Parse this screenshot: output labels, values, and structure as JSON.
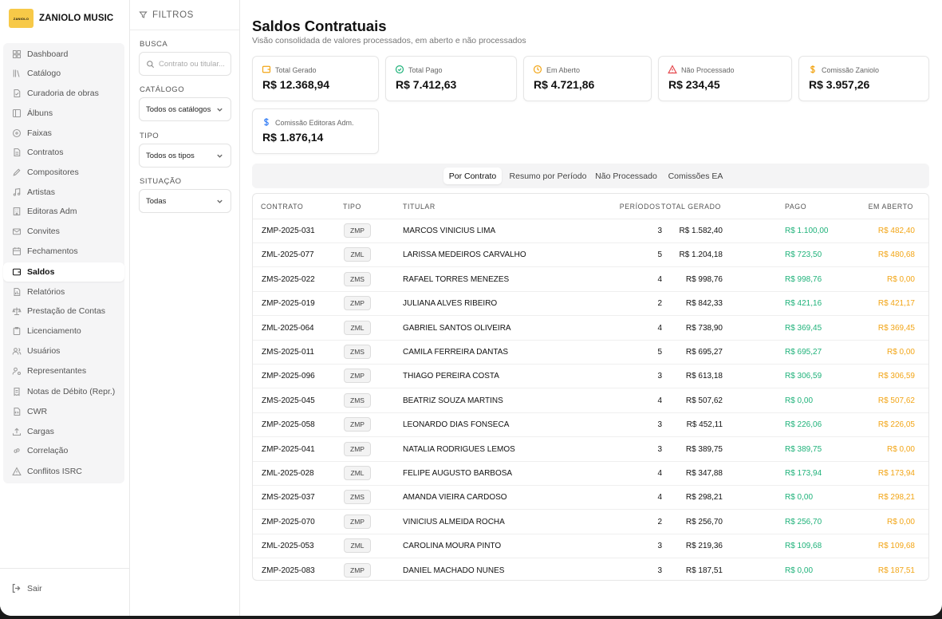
{
  "brand": {
    "logo_text": "ZANIOLO",
    "name": "ZANIOLO MUSIC"
  },
  "sidebar": {
    "items": [
      {
        "label": "Dashboard",
        "icon": "grid-icon",
        "active": false
      },
      {
        "label": "Catálogo",
        "icon": "library-icon",
        "active": false
      },
      {
        "label": "Curadoria de obras",
        "icon": "document-check-icon",
        "active": false
      },
      {
        "label": "Álbuns",
        "icon": "album-icon",
        "active": false
      },
      {
        "label": "Faixas",
        "icon": "disc-icon",
        "active": false
      },
      {
        "label": "Contratos",
        "icon": "file-text-icon",
        "active": false
      },
      {
        "label": "Compositores",
        "icon": "pen-icon",
        "active": false
      },
      {
        "label": "Artistas",
        "icon": "music-note-icon",
        "active": false
      },
      {
        "label": "Editoras Adm",
        "icon": "building-icon",
        "active": false
      },
      {
        "label": "Convites",
        "icon": "mail-icon",
        "active": false
      },
      {
        "label": "Fechamentos",
        "icon": "calendar-icon",
        "active": false
      },
      {
        "label": "Saldos",
        "icon": "wallet-icon",
        "active": true
      },
      {
        "label": "Relatórios",
        "icon": "report-icon",
        "active": false
      },
      {
        "label": "Prestação de Contas",
        "icon": "scale-icon",
        "active": false
      },
      {
        "label": "Licenciamento",
        "icon": "clipboard-icon",
        "active": false
      },
      {
        "label": "Usuários",
        "icon": "users-icon",
        "active": false
      },
      {
        "label": "Representantes",
        "icon": "user-gear-icon",
        "active": false
      },
      {
        "label": "Notas de Débito (Repr.)",
        "icon": "receipt-icon",
        "active": false
      },
      {
        "label": "CWR",
        "icon": "file-code-icon",
        "active": false
      },
      {
        "label": "Cargas",
        "icon": "upload-icon",
        "active": false
      },
      {
        "label": "Correlação",
        "icon": "link-icon",
        "active": false
      },
      {
        "label": "Conflitos ISRC",
        "icon": "warning-icon",
        "active": false
      }
    ],
    "logout_label": "Sair"
  },
  "filters": {
    "title": "FILTROS",
    "busca_label": "BUSCA",
    "busca_placeholder": "Contrato ou titular...",
    "catalogo_label": "CATÁLOGO",
    "catalogo_value": "Todos os catálogos",
    "tipo_label": "TIPO",
    "tipo_value": "Todos os tipos",
    "situacao_label": "SITUAÇÃO",
    "situacao_value": "Todas"
  },
  "header": {
    "title": "Saldos Contratuais",
    "subtitle": "Visão consolidada de valores processados, em aberto e não processados"
  },
  "cards": [
    {
      "label": "Total Gerado",
      "value": "R$ 12.368,94",
      "icon": "wallet-icon",
      "color": "#f2a516"
    },
    {
      "label": "Total Pago",
      "value": "R$ 7.412,63",
      "icon": "check-circle-icon",
      "color": "#1fb27a"
    },
    {
      "label": "Em Aberto",
      "value": "R$ 4.721,86",
      "icon": "clock-icon",
      "color": "#f2a516"
    },
    {
      "label": "Não Processado",
      "value": "R$ 234,45",
      "icon": "alert-triangle-icon",
      "color": "#e5484d"
    },
    {
      "label": "Comissão Zaniolo",
      "value": "R$ 3.957,26",
      "icon": "dollar-icon",
      "color": "#f2a516"
    },
    {
      "label": "Comissão Editoras Adm.",
      "value": "R$ 1.876,14",
      "icon": "dollar-icon",
      "color": "#3b82f6"
    }
  ],
  "tabs": [
    {
      "label": "Por Contrato",
      "active": true
    },
    {
      "label": "Resumo por Período",
      "active": false
    },
    {
      "label": "Não Processado",
      "active": false
    },
    {
      "label": "Comissões EA",
      "active": false
    }
  ],
  "table": {
    "columns": [
      "CONTRATO",
      "TIPO",
      "TITULAR",
      "PERÍODOS",
      "TOTAL  GERADO",
      "PAGO",
      "EM  ABERTO"
    ],
    "rows": [
      [
        "ZMP-2025-031",
        "ZMP",
        "MARCOS VINICIUS LIMA",
        "3",
        "R$ 1.582,40",
        "R$ 1.100,00",
        "R$ 482,40"
      ],
      [
        "ZML-2025-077",
        "ZML",
        "LARISSA MEDEIROS CARVALHO",
        "5",
        "R$ 1.204,18",
        "R$ 723,50",
        "R$ 480,68"
      ],
      [
        "ZMS-2025-022",
        "ZMS",
        "RAFAEL TORRES MENEZES",
        "4",
        "R$ 998,76",
        "R$ 998,76",
        "R$ 0,00"
      ],
      [
        "ZMP-2025-019",
        "ZMP",
        "JULIANA ALVES RIBEIRO",
        "2",
        "R$ 842,33",
        "R$ 421,16",
        "R$ 421,17"
      ],
      [
        "ZML-2025-064",
        "ZML",
        "GABRIEL SANTOS OLIVEIRA",
        "4",
        "R$ 738,90",
        "R$ 369,45",
        "R$ 369,45"
      ],
      [
        "ZMS-2025-011",
        "ZMS",
        "CAMILA FERREIRA DANTAS",
        "5",
        "R$ 695,27",
        "R$ 695,27",
        "R$ 0,00"
      ],
      [
        "ZMP-2025-096",
        "ZMP",
        "THIAGO PEREIRA COSTA",
        "3",
        "R$ 613,18",
        "R$ 306,59",
        "R$ 306,59"
      ],
      [
        "ZMS-2025-045",
        "ZMS",
        "BEATRIZ SOUZA MARTINS",
        "4",
        "R$ 507,62",
        "R$ 0,00",
        "R$ 507,62"
      ],
      [
        "ZMP-2025-058",
        "ZMP",
        "LEONARDO DIAS FONSECA",
        "3",
        "R$ 452,11",
        "R$ 226,06",
        "R$ 226,05"
      ],
      [
        "ZMP-2025-041",
        "ZMP",
        "NATALIA RODRIGUES LEMOS",
        "3",
        "R$ 389,75",
        "R$ 389,75",
        "R$ 0,00"
      ],
      [
        "ZML-2025-028",
        "ZML",
        "FELIPE AUGUSTO BARBOSA",
        "4",
        "R$ 347,88",
        "R$ 173,94",
        "R$ 173,94"
      ],
      [
        "ZMS-2025-037",
        "ZMS",
        "AMANDA VIEIRA CARDOSO",
        "4",
        "R$ 298,21",
        "R$ 0,00",
        "R$ 298,21"
      ],
      [
        "ZMP-2025-070",
        "ZMP",
        "VINICIUS ALMEIDA ROCHA",
        "2",
        "R$ 256,70",
        "R$ 256,70",
        "R$ 0,00"
      ],
      [
        "ZML-2025-053",
        "ZML",
        "CAROLINA MOURA PINTO",
        "3",
        "R$ 219,36",
        "R$ 109,68",
        "R$ 109,68"
      ],
      [
        "ZMP-2025-083",
        "ZMP",
        "DANIEL MACHADO NUNES",
        "3",
        "R$ 187,51",
        "R$ 0,00",
        "R$ 187,51"
      ]
    ]
  },
  "colors": {
    "brand": "#f7c948",
    "paid": "#1fb27a",
    "open": "#f2a516"
  }
}
